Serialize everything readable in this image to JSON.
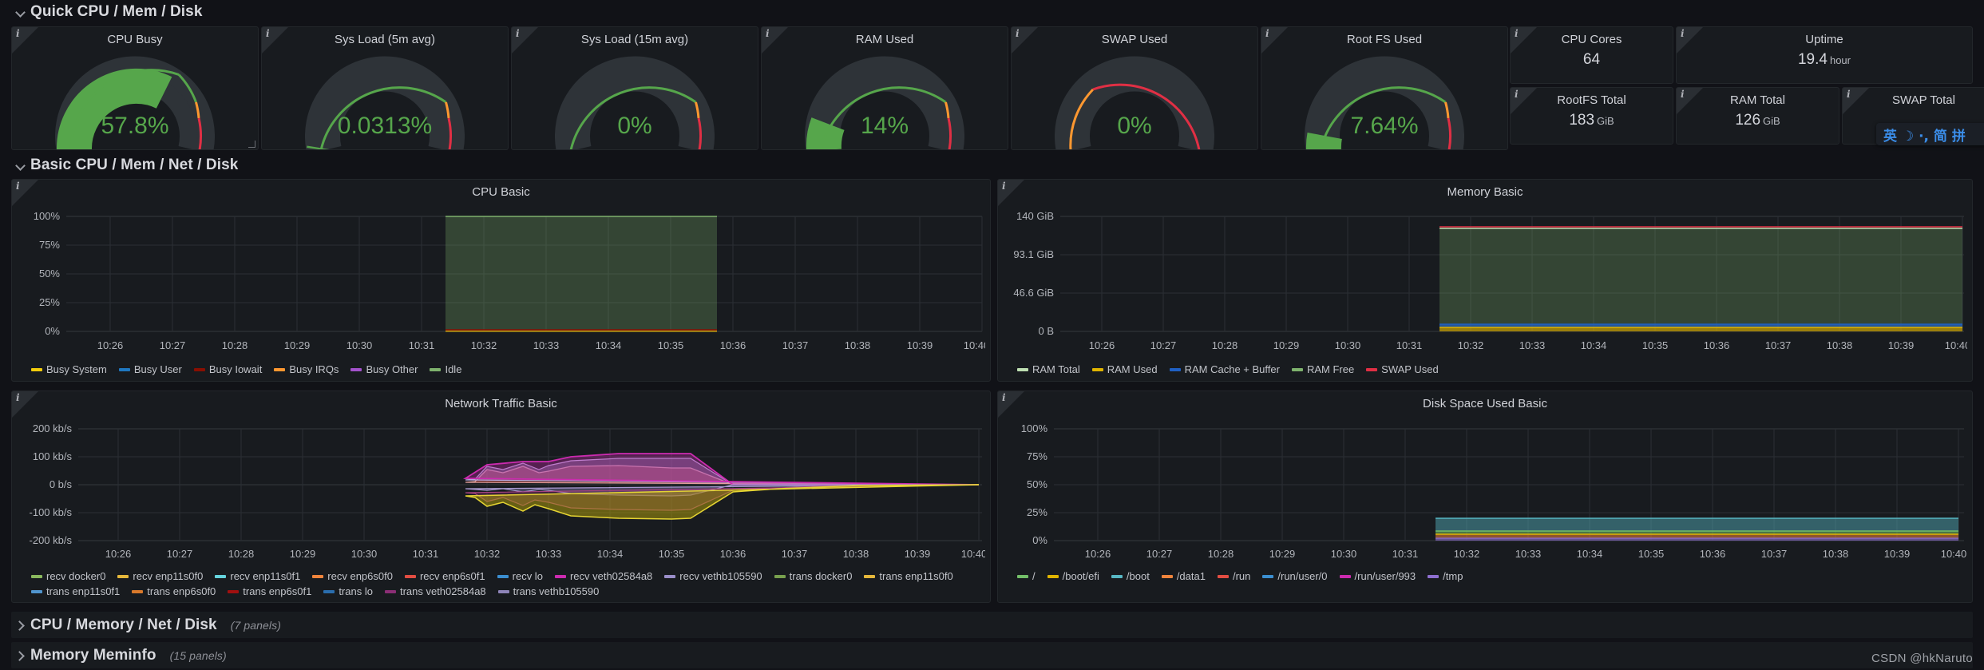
{
  "dashboard": {
    "background": "#111217",
    "panel_bg": "#181b1f",
    "watermark": "CSDN @hkNaruto"
  },
  "rows": [
    {
      "name": "quick",
      "title": "Quick CPU / Mem / Disk",
      "collapsed": false,
      "panel_count": ""
    },
    {
      "name": "basic",
      "title": "Basic CPU / Mem / Net / Disk",
      "collapsed": false,
      "panel_count": ""
    },
    {
      "name": "cpu_memory_net_disk",
      "title": "CPU / Memory / Net / Disk",
      "collapsed": true,
      "panel_count": "(7 panels)"
    },
    {
      "name": "memory_meminfo",
      "title": "Memory Meminfo",
      "collapsed": true,
      "panel_count": "(15 panels)"
    }
  ],
  "gauges": [
    {
      "title": "CPU Busy",
      "value": "57.8%",
      "pct": 57.8,
      "color": "#56a64b"
    },
    {
      "title": "Sys Load (5m avg)",
      "value": "0.0313%",
      "pct": 0.0313,
      "color": "#56a64b"
    },
    {
      "title": "Sys Load (15m avg)",
      "value": "0%",
      "pct": 0,
      "color": "#56a64b"
    },
    {
      "title": "RAM Used",
      "value": "14%",
      "pct": 14,
      "color": "#56a64b"
    },
    {
      "title": "SWAP Used",
      "value": "0%",
      "pct": 0,
      "color": "#56a64b",
      "track": "red"
    },
    {
      "title": "Root FS Used",
      "value": "7.64%",
      "pct": 7.64,
      "color": "#56a64b"
    }
  ],
  "stats": [
    {
      "title": "CPU Cores",
      "value": "64",
      "unit": ""
    },
    {
      "title": "Uptime",
      "value": "19.4",
      "unit": "hour"
    },
    {
      "title": "RootFS Total",
      "value": "183",
      "unit": "GiB"
    },
    {
      "title": "RAM Total",
      "value": "126",
      "unit": "GiB"
    },
    {
      "title": "SWAP Total",
      "value": "",
      "unit": ""
    }
  ],
  "ime": {
    "text": "英 ☽ ·, 简 拼",
    "color": "#3b8eea"
  },
  "chart_data": [
    {
      "name": "cpu_basic",
      "type": "area",
      "title": "CPU Basic",
      "stacked": true,
      "xlabel": "",
      "ylabel": "",
      "ylim": [
        0,
        100
      ],
      "yticks": [
        "0%",
        "25%",
        "50%",
        "75%",
        "100%"
      ],
      "ytick_values": [
        0,
        25,
        50,
        75,
        100
      ],
      "xticks": [
        "10:26",
        "10:27",
        "10:28",
        "10:29",
        "10:30",
        "10:31",
        "10:32",
        "10:33",
        "10:34",
        "10:35",
        "10:36",
        "10:37",
        "10:38",
        "10:39",
        "10:40"
      ],
      "grid": true,
      "legend_position": "bottom",
      "data_start_tick": "10:31.7",
      "data_end_tick": "10:36.8",
      "series": [
        {
          "name": "Busy System",
          "color": "#f2cc0c",
          "values": [
            0.9
          ]
        },
        {
          "name": "Busy User",
          "color": "#1f78c1",
          "values": [
            0.4
          ]
        },
        {
          "name": "Busy Iowait",
          "color": "#890f02",
          "values": [
            0.3
          ]
        },
        {
          "name": "Busy IRQs",
          "color": "#ff9830",
          "values": [
            0.1
          ]
        },
        {
          "name": "Busy Other",
          "color": "#a352cc",
          "values": [
            0.1
          ]
        },
        {
          "name": "Idle",
          "color": "#7eb26d",
          "values": [
            98.2
          ]
        }
      ]
    },
    {
      "name": "memory_basic",
      "type": "area",
      "title": "Memory Basic",
      "stacked": true,
      "ylim": [
        0,
        140
      ],
      "yticks": [
        "0 B",
        "46.6 GiB",
        "93.1 GiB",
        "140 GiB"
      ],
      "ytick_values": [
        0,
        46.6,
        93.1,
        140
      ],
      "xticks": [
        "10:26",
        "10:27",
        "10:28",
        "10:29",
        "10:30",
        "10:31",
        "10:32",
        "10:33",
        "10:34",
        "10:35",
        "10:36",
        "10:37",
        "10:38",
        "10:39",
        "10:40"
      ],
      "grid": true,
      "legend_position": "bottom",
      "data_start_tick": "10:31.5",
      "data_end_tick": "10:40",
      "series": [
        {
          "name": "RAM Total",
          "color": "#bedfb2",
          "values": [
            126
          ]
        },
        {
          "name": "RAM Used",
          "color": "#e0b400",
          "values": [
            17.6
          ]
        },
        {
          "name": "RAM Cache + Buffer",
          "color": "#1f60c4",
          "values": [
            2.1
          ]
        },
        {
          "name": "RAM Free",
          "color": "#7eb26d",
          "values": [
            106
          ]
        },
        {
          "name": "SWAP Used",
          "color": "#e02f44",
          "values": [
            0
          ]
        }
      ]
    },
    {
      "name": "network_traffic_basic",
      "type": "area",
      "title": "Network Traffic Basic",
      "stacked": true,
      "ylim": [
        -200,
        200
      ],
      "yticks": [
        "-200 kb/s",
        "-100 kb/s",
        "0 b/s",
        "100 kb/s",
        "200 kb/s"
      ],
      "ytick_values": [
        -200,
        -100,
        0,
        100,
        200
      ],
      "xticks": [
        "10:26",
        "10:27",
        "10:28",
        "10:29",
        "10:30",
        "10:31",
        "10:32",
        "10:33",
        "10:34",
        "10:35",
        "10:36",
        "10:37",
        "10:38",
        "10:39",
        "10:40"
      ],
      "grid": true,
      "legend_position": "bottom",
      "data_start_tick": "10:31.7",
      "data_end_tick": "10:37",
      "series": [
        {
          "name": "recv docker0",
          "color": "#8ab85e",
          "values": [
            0
          ]
        },
        {
          "name": "recv enp11s0f0",
          "color": "#e5b73b",
          "values": [
            0
          ]
        },
        {
          "name": "recv enp11s0f1",
          "color": "#65d3dd",
          "values": [
            0
          ]
        },
        {
          "name": "recv enp6s0f0",
          "color": "#ef843c",
          "values": [
            0
          ]
        },
        {
          "name": "recv enp6s0f1",
          "color": "#e24d42",
          "values": [
            14
          ]
        },
        {
          "name": "recv lo",
          "color": "#3b8ed0",
          "values": [
            0
          ]
        },
        {
          "name": "recv veth02584a8",
          "color": "#cc2bb0",
          "values": [
            10
          ]
        },
        {
          "name": "recv vethb105590",
          "color": "#9a8ec9",
          "values": [
            8
          ]
        },
        {
          "name": "trans docker0",
          "color": "#78a04e",
          "values": [
            0
          ]
        },
        {
          "name": "trans enp11s0f0",
          "color": "#e5b73b",
          "values": [
            0
          ]
        },
        {
          "name": "trans enp11s0f1",
          "color": "#5195ce",
          "values": [
            0
          ]
        },
        {
          "name": "trans enp6s0f0",
          "color": "#d9792b",
          "values": [
            0
          ]
        },
        {
          "name": "trans enp6s0f1",
          "color": "#a01010",
          "values": [
            -20
          ]
        },
        {
          "name": "trans lo",
          "color": "#2a6dad",
          "values": [
            0
          ]
        },
        {
          "name": "trans veth02584a8",
          "color": "#8b2e75",
          "values": [
            -15
          ]
        },
        {
          "name": "trans vethb105590",
          "color": "#8e84b8",
          "values": [
            -30
          ]
        }
      ]
    },
    {
      "name": "disk_space_used_basic",
      "type": "area",
      "title": "Disk Space Used Basic",
      "stacked": true,
      "ylim": [
        0,
        100
      ],
      "yticks": [
        "0%",
        "25%",
        "50%",
        "75%",
        "100%"
      ],
      "ytick_values": [
        0,
        25,
        50,
        75,
        100
      ],
      "xticks": [
        "10:26",
        "10:27",
        "10:28",
        "10:29",
        "10:30",
        "10:31",
        "10:32",
        "10:33",
        "10:34",
        "10:35",
        "10:36",
        "10:37",
        "10:38",
        "10:39",
        "10:40"
      ],
      "grid": true,
      "legend_position": "bottom",
      "data_start_tick": "10:31.5",
      "data_end_tick": "10:40",
      "series": [
        {
          "name": "/",
          "color": "#73bf69",
          "values": [
            7.6
          ]
        },
        {
          "name": "/boot/efi",
          "color": "#e0b400",
          "values": [
            2.0
          ]
        },
        {
          "name": "/boot",
          "color": "#57b7c4",
          "values": [
            8.5
          ]
        },
        {
          "name": "/data1",
          "color": "#ef843c",
          "values": [
            1.5
          ]
        },
        {
          "name": "/run",
          "color": "#e24d42",
          "values": [
            0.3
          ]
        },
        {
          "name": "/run/user/0",
          "color": "#3b8ed0",
          "values": [
            0
          ]
        },
        {
          "name": "/run/user/993",
          "color": "#cc2bb0",
          "values": [
            0
          ]
        },
        {
          "name": "/tmp",
          "color": "#8e6fd0",
          "values": [
            0.6
          ]
        }
      ]
    }
  ]
}
